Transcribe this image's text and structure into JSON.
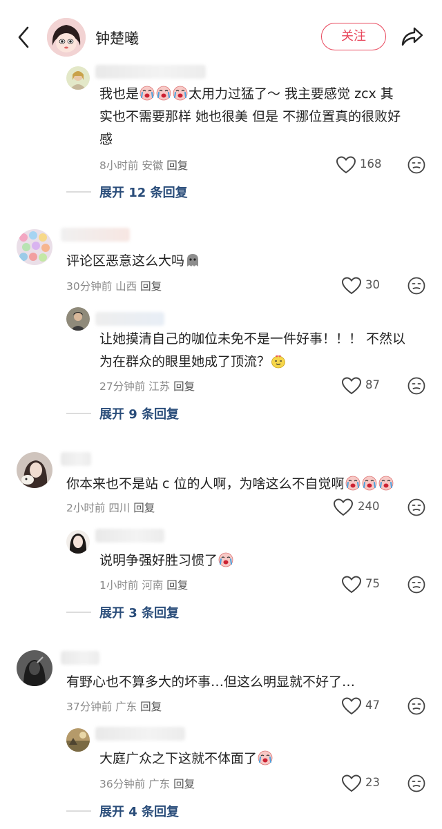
{
  "header": {
    "title": "钟楚曦",
    "follow_label": "关注"
  },
  "comments": [
    {
      "text_a": "我也是",
      "text_b": "太用力过猛了～ 我主要感觉 zcx 其实也不需要那样 她也很美 但是 不挪位置真的很败好感",
      "line2": "实也不需要那样 她也很美 但是 不挪位置真的很败好",
      "line3": "感",
      "line1_tail": "太用力过猛了～ 我主要感觉 zcx 其",
      "time": "8小时前",
      "location": "安徽",
      "reply_label": "回复",
      "likes": "168",
      "expand": "展开 12 条回复"
    },
    {
      "text": "评论区恶意这么大吗",
      "time": "30分钟前",
      "location": "山西",
      "reply_label": "回复",
      "likes": "30"
    },
    {
      "line1": "让她摸清自己的咖位未免不是一件好事！！！ 不然以",
      "line2": "为在群众的眼里她成了顶流？",
      "time": "27分钟前",
      "location": "江苏",
      "reply_label": "回复",
      "likes": "87",
      "expand": "展开 9 条回复"
    },
    {
      "text": "你本来也不是站 c 位的人啊，为啥这么不自觉啊",
      "time": "2小时前",
      "location": "四川",
      "reply_label": "回复",
      "likes": "240"
    },
    {
      "text": "说明争强好胜习惯了",
      "time": "1小时前",
      "location": "河南",
      "reply_label": "回复",
      "likes": "75",
      "expand": "展开 3 条回复"
    },
    {
      "text": "有野心也不算多大的坏事…但这么明显就不好了…",
      "time": "37分钟前",
      "location": "广东",
      "reply_label": "回复",
      "likes": "47"
    },
    {
      "text": "大庭广众之下这就不体面了",
      "time": "36分钟前",
      "location": "广东",
      "reply_label": "回复",
      "likes": "23",
      "expand": "展开 4 条回复"
    }
  ],
  "colors": {
    "accent": "#e8455a",
    "expand": "#2a4d7a",
    "meta": "#8a8a8a"
  },
  "icons": [
    "back-arrow-icon",
    "share-icon",
    "heart-icon",
    "dislike-face-icon",
    "crying-face-emoji",
    "ghost-emoji",
    "smug-face-emoji"
  ]
}
